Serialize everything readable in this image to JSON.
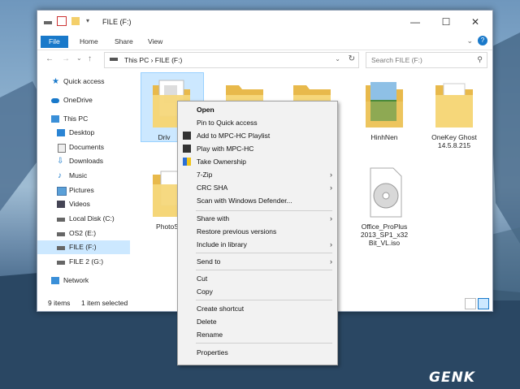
{
  "window": {
    "title": "FILE (F:)",
    "controls": {
      "minimize": "—",
      "maximize": "☐",
      "close": "✕"
    }
  },
  "ribbon": {
    "tabs": [
      "File",
      "Home",
      "Share",
      "View"
    ],
    "help": "?"
  },
  "address": {
    "path": "This PC  ›  FILE (F:)",
    "search_placeholder": "Search FILE (F:)"
  },
  "nav": {
    "items": [
      {
        "label": "Quick access",
        "icon": "star-icon"
      },
      {
        "label": "OneDrive",
        "icon": "cloud-icon"
      },
      {
        "label": "This PC",
        "icon": "computer-icon"
      },
      {
        "label": "Desktop",
        "icon": "desktop-icon"
      },
      {
        "label": "Documents",
        "icon": "documents-icon"
      },
      {
        "label": "Downloads",
        "icon": "download-icon"
      },
      {
        "label": "Music",
        "icon": "music-icon"
      },
      {
        "label": "Pictures",
        "icon": "pictures-icon"
      },
      {
        "label": "Videos",
        "icon": "video-icon"
      },
      {
        "label": "Local Disk (C:)",
        "icon": "drive-icon"
      },
      {
        "label": "OS2 (E:)",
        "icon": "drive-icon"
      },
      {
        "label": "FILE (F:)",
        "icon": "drive-icon",
        "selected": true
      },
      {
        "label": "FILE 2 (G:)",
        "icon": "drive-icon"
      },
      {
        "label": "Network",
        "icon": "network-icon"
      }
    ]
  },
  "files": [
    {
      "label": "Driv",
      "type": "folder"
    },
    {
      "label": "",
      "type": "folder"
    },
    {
      "label": "",
      "type": "folder"
    },
    {
      "label": "HinhNen",
      "type": "folder"
    },
    {
      "label": "OneKey Ghost 14.5.8.215",
      "type": "folder"
    },
    {
      "label": "PhotoS",
      "type": "folder"
    },
    {
      "label": "Office_ProPlus 2013_SP1_x32 Bit_VL.iso",
      "type": "disc-image"
    }
  ],
  "status": {
    "count": "9 items",
    "selected": "1 item selected"
  },
  "context_menu": {
    "items": [
      {
        "label": "Open",
        "bold": true
      },
      {
        "label": "Pin to Quick access"
      },
      {
        "label": "Add to MPC-HC Playlist",
        "icon": "mpc-icon"
      },
      {
        "label": "Play with MPC-HC",
        "icon": "mpc-icon"
      },
      {
        "label": "Take Ownership",
        "icon": "shield-icon"
      },
      {
        "label": "7-Zip",
        "submenu": true
      },
      {
        "label": "CRC SHA",
        "submenu": true
      },
      {
        "label": "Scan with Windows Defender...",
        "icon": "defender-icon"
      },
      {
        "label": "Share with",
        "submenu": true
      },
      {
        "label": "Restore previous versions"
      },
      {
        "label": "Include in library",
        "submenu": true
      },
      {
        "label": "Send to",
        "submenu": true
      },
      {
        "label": "Cut"
      },
      {
        "label": "Copy"
      },
      {
        "label": "Create shortcut"
      },
      {
        "label": "Delete"
      },
      {
        "label": "Rename"
      },
      {
        "label": "Properties"
      }
    ],
    "submenu_arrow": "›"
  },
  "watermark": "GENK",
  "colors": {
    "accent": "#1979ca",
    "folder": "#f4cf6a",
    "selection": "#cce8ff"
  }
}
